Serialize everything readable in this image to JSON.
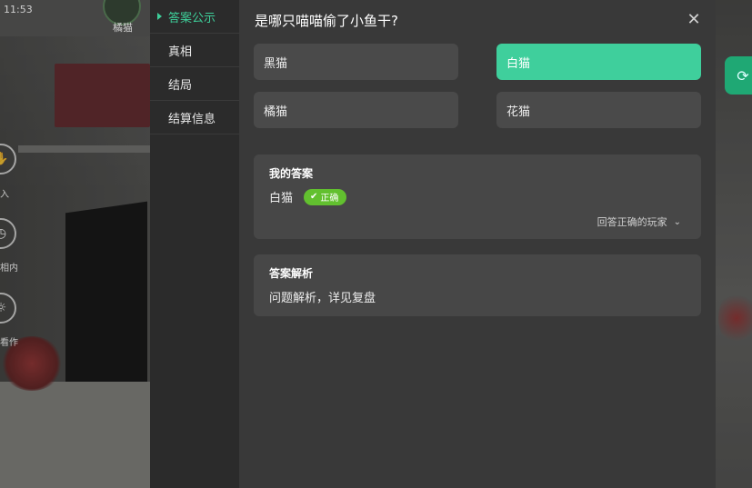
{
  "status_bar": {
    "time": "11:53"
  },
  "top_player": {
    "name": "橘猫"
  },
  "left_tools": [
    {
      "icon": "hand-icon",
      "label": "入"
    },
    {
      "icon": "clock-icon",
      "label": "相内"
    },
    {
      "icon": "bulb-icon",
      "label": "看作"
    }
  ],
  "menu": {
    "items": [
      {
        "label": "答案公示",
        "active": true
      },
      {
        "label": "真相",
        "active": false
      },
      {
        "label": "结局",
        "active": false
      },
      {
        "label": "结算信息",
        "active": false
      }
    ]
  },
  "question": {
    "title": "是哪只喵喵偷了小鱼干?",
    "options": [
      {
        "label": "黑猫",
        "selected": false
      },
      {
        "label": "白猫",
        "selected": true
      },
      {
        "label": "橘猫",
        "selected": false
      },
      {
        "label": "花猫",
        "selected": false
      }
    ]
  },
  "my_answer": {
    "title": "我的答案",
    "value": "白猫",
    "badge": "正确",
    "players_link": "回答正确的玩家"
  },
  "analysis": {
    "title": "答案解析",
    "text": "问题解析，详见复盘"
  },
  "colors": {
    "accent": "#3fcf9c",
    "correct_badge": "#62c02f",
    "panel_bg": "#393939",
    "card_bg": "#474747"
  }
}
